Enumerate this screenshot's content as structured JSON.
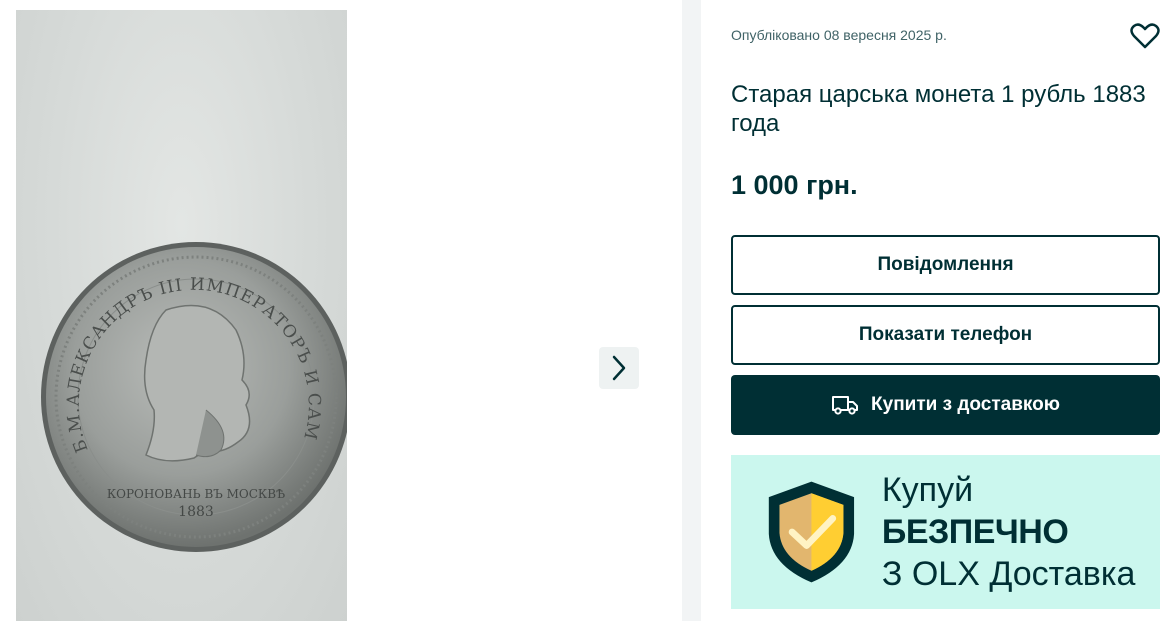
{
  "gallery": {
    "photo_alt": "Монета 1 рубль 1883",
    "coin_legend": "Б.М.АЛЕКСАНДРЪ III ИМПЕРАТОРЪ И САМОДЕРЖ. ВСЕРОСС.",
    "coin_bottom": "КОРОНОВАНЬ ВЪ МОСКВѢ",
    "coin_year": "1883",
    "next_icon": "chevron-right-icon"
  },
  "listing": {
    "published": "Опубліковано 08 вересня 2025 р.",
    "favorite_icon": "heart-icon",
    "title": "Старая царська монета 1 рубль 1883 года",
    "price": "1 000 грн.",
    "message_button": "Повідомлення",
    "phone_button": "Показати телефон",
    "buy_button": "Купити з доставкою",
    "buy_icon": "truck-icon"
  },
  "banner": {
    "line1_normal": "Купуй ",
    "line1_bold": "БЕЗПЕЧНО",
    "line2": "З OLX Доставка",
    "icon": "shield-check-icon"
  },
  "colors": {
    "primary": "#002f34",
    "banner_bg": "#cbf7ee",
    "shield_yellow": "#ffce32"
  }
}
